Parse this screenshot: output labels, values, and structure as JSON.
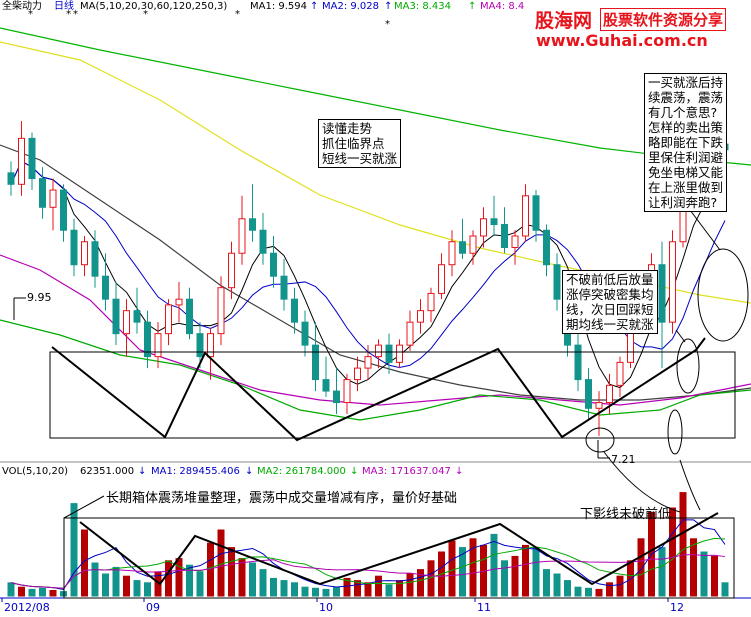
{
  "header": {
    "stock_name": "全柴动力",
    "period": "日线",
    "ma_params": "MA(5,10,20,30,60,120,250,3)",
    "ma1": "MA1: 9.594",
    "ma2": "MA2: 9.028",
    "ma3": "MA3: 8.434",
    "ma4": "MA4: 8.4",
    "arrow": "↑"
  },
  "watermark": {
    "brand": "股海网",
    "slogan": "股票软件资源分享",
    "url": "www.Guhai.com.cn"
  },
  "volume_header": {
    "params": "VOL(5,10,20)",
    "vol": "62351.000",
    "ma1": "MA1: 289455.406",
    "ma2": "MA2: 261784.000",
    "ma3": "MA3: 171637.047",
    "down": "↓"
  },
  "annotations": {
    "read_trend": [
      "读懂走势",
      "抓住临界点",
      "短线一买就涨"
    ],
    "question": [
      "一买就涨后持",
      "续震荡，震荡",
      "有几个意思?",
      "怎样的卖出策",
      "略即能在下跌",
      "里保住利润避",
      "免坐电梯又能",
      "在上涨里做到",
      "让利润奔跑?"
    ],
    "breakout": [
      "不破前低后放量",
      "涨停突破密集均",
      "线，次日回踩短",
      "期均线一买就涨"
    ],
    "box_note": "长期箱体震荡堆量整理，震荡中成交量增减有序，量价好基础",
    "lower_shadow": "下影线未破前低"
  },
  "colors": {
    "up": "#e8141b",
    "down": "#12948c",
    "ma1": "#000000",
    "ma2": "#b400b4",
    "ma3": "#00aa00",
    "ma4": "#0000c8",
    "ma120": "#e0e020",
    "ma250": "#00b400",
    "vol_up": "#b40000",
    "vol_down": "#12948c"
  },
  "chart_data": {
    "type": "candlestick",
    "x_axis_labels": [
      "2012/08",
      "09",
      "10",
      "11",
      "12"
    ],
    "price_markers": {
      "high": 9.95,
      "low": 7.21
    },
    "price_range": [
      7.0,
      10.9
    ],
    "candles": [
      [
        9.5,
        9.6,
        9.3,
        9.4
      ],
      [
        9.4,
        9.95,
        9.3,
        9.8
      ],
      [
        9.8,
        9.85,
        9.35,
        9.45
      ],
      [
        9.45,
        9.55,
        9.1,
        9.2
      ],
      [
        9.2,
        9.45,
        9.0,
        9.35
      ],
      [
        9.35,
        9.4,
        8.9,
        9.0
      ],
      [
        9.0,
        9.1,
        8.6,
        8.7
      ],
      [
        8.7,
        8.95,
        8.6,
        8.9
      ],
      [
        8.9,
        9.0,
        8.5,
        8.6
      ],
      [
        8.6,
        8.8,
        8.3,
        8.4
      ],
      [
        8.4,
        8.55,
        8.0,
        8.1
      ],
      [
        8.1,
        8.4,
        7.9,
        8.3
      ],
      [
        8.3,
        8.5,
        8.1,
        8.2
      ],
      [
        8.2,
        8.3,
        7.8,
        7.9
      ],
      [
        7.9,
        8.2,
        7.8,
        8.1
      ],
      [
        8.1,
        8.4,
        8.0,
        8.35
      ],
      [
        8.35,
        8.55,
        8.2,
        8.4
      ],
      [
        8.4,
        8.5,
        8.05,
        8.1
      ],
      [
        8.1,
        8.2,
        7.8,
        7.9
      ],
      [
        7.9,
        8.15,
        7.7,
        8.1
      ],
      [
        8.1,
        8.6,
        8.0,
        8.5
      ],
      [
        8.5,
        8.9,
        8.4,
        8.8
      ],
      [
        8.8,
        9.3,
        8.7,
        9.1
      ],
      [
        9.1,
        9.4,
        8.9,
        9.0
      ],
      [
        9.0,
        9.15,
        8.7,
        8.8
      ],
      [
        8.8,
        8.95,
        8.5,
        8.6
      ],
      [
        8.6,
        8.75,
        8.3,
        8.4
      ],
      [
        8.4,
        8.5,
        8.1,
        8.2
      ],
      [
        8.2,
        8.3,
        7.9,
        8.0
      ],
      [
        8.0,
        8.2,
        7.6,
        7.7
      ],
      [
        7.7,
        7.9,
        7.55,
        7.6
      ],
      [
        7.6,
        7.8,
        7.4,
        7.5
      ],
      [
        7.5,
        7.75,
        7.4,
        7.7
      ],
      [
        7.7,
        7.9,
        7.6,
        7.8
      ],
      [
        7.8,
        8.0,
        7.7,
        7.9
      ],
      [
        7.9,
        8.05,
        7.8,
        8.0
      ],
      [
        8.0,
        8.1,
        7.75,
        7.85
      ],
      [
        7.85,
        8.05,
        7.8,
        8.0
      ],
      [
        8.0,
        8.3,
        7.95,
        8.2
      ],
      [
        8.2,
        8.4,
        8.1,
        8.3
      ],
      [
        8.3,
        8.5,
        8.2,
        8.45
      ],
      [
        8.45,
        8.8,
        8.4,
        8.7
      ],
      [
        8.7,
        9.0,
        8.6,
        8.9
      ],
      [
        8.9,
        9.1,
        8.75,
        8.8
      ],
      [
        8.8,
        9.0,
        8.7,
        8.95
      ],
      [
        8.95,
        9.2,
        8.85,
        9.1
      ],
      [
        9.1,
        9.3,
        8.95,
        9.05
      ],
      [
        9.05,
        9.2,
        8.8,
        8.85
      ],
      [
        8.85,
        9.0,
        8.7,
        8.95
      ],
      [
        8.95,
        9.4,
        8.9,
        9.3
      ],
      [
        9.3,
        9.35,
        8.9,
        9.0
      ],
      [
        9.0,
        9.05,
        8.6,
        8.7
      ],
      [
        8.7,
        8.8,
        8.3,
        8.4
      ],
      [
        8.4,
        8.5,
        7.9,
        8.0
      ],
      [
        8.0,
        8.1,
        7.6,
        7.7
      ],
      [
        7.7,
        7.8,
        7.35,
        7.45
      ],
      [
        7.45,
        7.6,
        7.21,
        7.5
      ],
      [
        7.5,
        7.75,
        7.4,
        7.65
      ],
      [
        7.65,
        7.9,
        7.55,
        7.85
      ],
      [
        7.85,
        8.2,
        7.8,
        8.15
      ],
      [
        8.15,
        8.5,
        8.1,
        8.45
      ],
      [
        8.45,
        8.8,
        8.35,
        8.7
      ],
      [
        8.7,
        8.9,
        7.8,
        8.2
      ],
      [
        8.2,
        9.0,
        8.1,
        8.9
      ],
      [
        8.9,
        9.55,
        8.85,
        9.5
      ],
      [
        9.5,
        10.0,
        9.4,
        9.9
      ],
      [
        9.9,
        10.0,
        9.45,
        9.6
      ],
      [
        9.6,
        9.85,
        9.4,
        9.75
      ],
      [
        9.75,
        9.9,
        9.55,
        9.7
      ]
    ],
    "volume": [
      60,
      40,
      30,
      35,
      25,
      20,
      420,
      300,
      150,
      100,
      130,
      90,
      70,
      60,
      110,
      160,
      170,
      140,
      110,
      240,
      300,
      220,
      170,
      150,
      120,
      80,
      70,
      60,
      40,
      35,
      30,
      40,
      80,
      70,
      60,
      90,
      50,
      70,
      100,
      120,
      160,
      200,
      250,
      220,
      260,
      230,
      280,
      160,
      180,
      230,
      220,
      120,
      100,
      70,
      40,
      35,
      30,
      60,
      90,
      160,
      260,
      380,
      220,
      400,
      470,
      260,
      200,
      180,
      60
    ]
  }
}
